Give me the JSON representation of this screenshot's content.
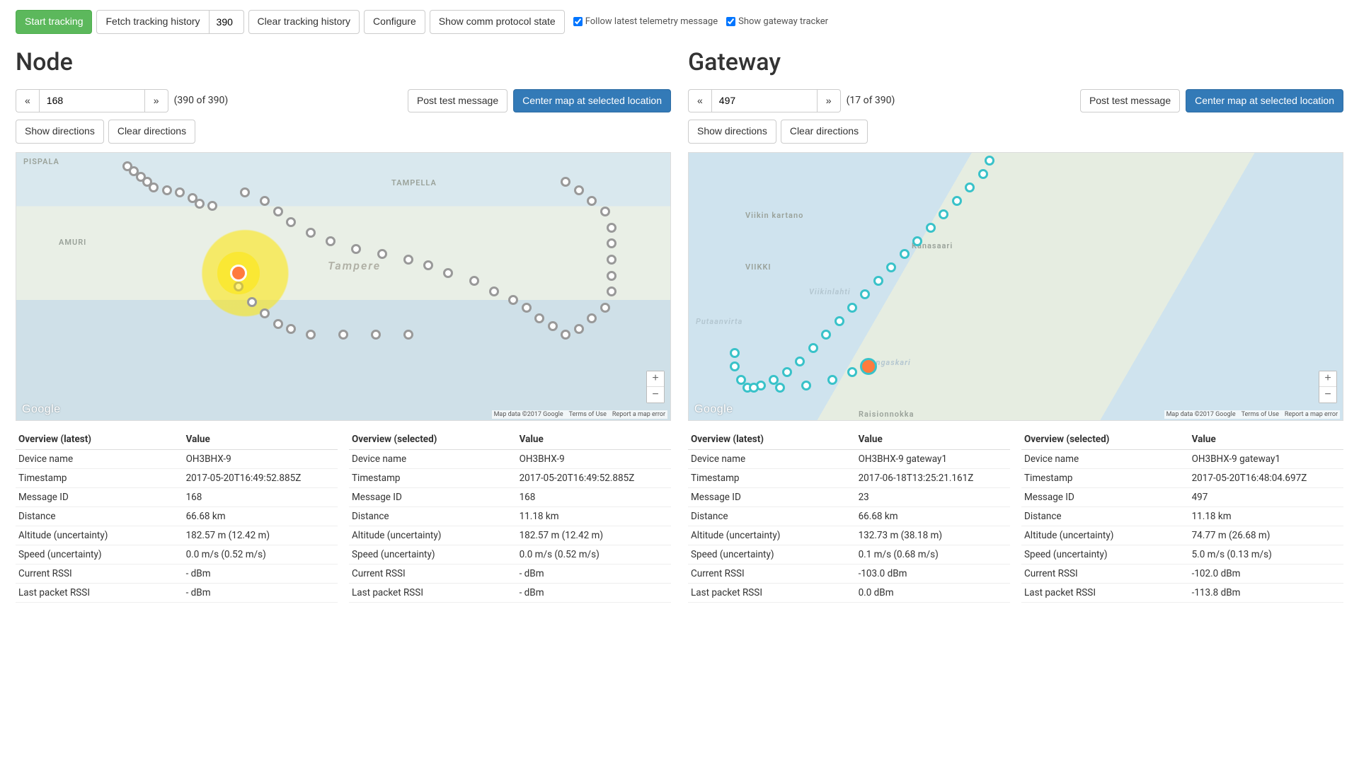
{
  "toolbar": {
    "start": "Start tracking",
    "fetch": "Fetch tracking history",
    "fetch_value": "390",
    "clear_history": "Clear tracking history",
    "configure": "Configure",
    "show_proto": "Show comm protocol state",
    "follow_label": "Follow latest telemetry message",
    "show_gw_label": "Show gateway tracker"
  },
  "node": {
    "title": "Node",
    "pager_value": "168",
    "count": "(390 of 390)",
    "post_test": "Post test message",
    "center_map": "Center map at selected location",
    "show_dir": "Show directions",
    "clear_dir": "Clear directions",
    "map": {
      "logo": "Google",
      "attrib_data": "Map data ©2017 Google",
      "attrib_terms": "Terms of Use",
      "attrib_report": "Report a map error",
      "labels": [
        "PISPALA",
        "AMURI",
        "TAMPELLA",
        "Tampere"
      ]
    },
    "latest": {
      "header": [
        "Overview (latest)",
        "Value"
      ],
      "rows": [
        [
          "Device name",
          "OH3BHX-9"
        ],
        [
          "Timestamp",
          "2017-05-20T16:49:52.885Z"
        ],
        [
          "Message ID",
          "168"
        ],
        [
          "Distance",
          "66.68 km"
        ],
        [
          "Altitude (uncertainty)",
          "182.57 m (12.42 m)"
        ],
        [
          "Speed (uncertainty)",
          "0.0 m/s (0.52 m/s)"
        ],
        [
          "Current RSSI",
          "- dBm"
        ],
        [
          "Last packet RSSI",
          "- dBm"
        ]
      ]
    },
    "selected": {
      "header": [
        "Overview (selected)",
        "Value"
      ],
      "rows": [
        [
          "Device name",
          "OH3BHX-9"
        ],
        [
          "Timestamp",
          "2017-05-20T16:49:52.885Z"
        ],
        [
          "Message ID",
          "168"
        ],
        [
          "Distance",
          "11.18 km"
        ],
        [
          "Altitude (uncertainty)",
          "182.57 m (12.42 m)"
        ],
        [
          "Speed (uncertainty)",
          "0.0 m/s (0.52 m/s)"
        ],
        [
          "Current RSSI",
          "- dBm"
        ],
        [
          "Last packet RSSI",
          "- dBm"
        ]
      ]
    }
  },
  "gateway": {
    "title": "Gateway",
    "pager_value": "497",
    "count": "(17 of 390)",
    "post_test": "Post test message",
    "center_map": "Center map at selected location",
    "show_dir": "Show directions",
    "clear_dir": "Clear directions",
    "map": {
      "logo": "Google",
      "attrib_data": "Map data ©2017 Google",
      "attrib_terms": "Terms of Use",
      "attrib_report": "Report a map error",
      "labels": [
        "Viikin kartano",
        "VIIKKI",
        "Viikinlahti",
        "Putaanvirta",
        "Rengaskari",
        "Raisionnokka",
        "Kanasaari"
      ]
    },
    "latest": {
      "header": [
        "Overview (latest)",
        "Value"
      ],
      "rows": [
        [
          "Device name",
          "OH3BHX-9 gateway1"
        ],
        [
          "Timestamp",
          "2017-06-18T13:25:21.161Z"
        ],
        [
          "Message ID",
          "23"
        ],
        [
          "Distance",
          "66.68 km"
        ],
        [
          "Altitude (uncertainty)",
          "132.73 m (38.18 m)"
        ],
        [
          "Speed (uncertainty)",
          "0.1 m/s (0.68 m/s)"
        ],
        [
          "Current RSSI",
          "-103.0 dBm"
        ],
        [
          "Last packet RSSI",
          "0.0 dBm"
        ]
      ]
    },
    "selected": {
      "header": [
        "Overview (selected)",
        "Value"
      ],
      "rows": [
        [
          "Device name",
          "OH3BHX-9 gateway1"
        ],
        [
          "Timestamp",
          "2017-05-20T16:48:04.697Z"
        ],
        [
          "Message ID",
          "497"
        ],
        [
          "Distance",
          "11.18 km"
        ],
        [
          "Altitude (uncertainty)",
          "74.77 m (26.68 m)"
        ],
        [
          "Speed (uncertainty)",
          "5.0 m/s (0.13 m/s)"
        ],
        [
          "Current RSSI",
          "-102.0 dBm"
        ],
        [
          "Last packet RSSI",
          "-113.8 dBm"
        ]
      ]
    }
  }
}
